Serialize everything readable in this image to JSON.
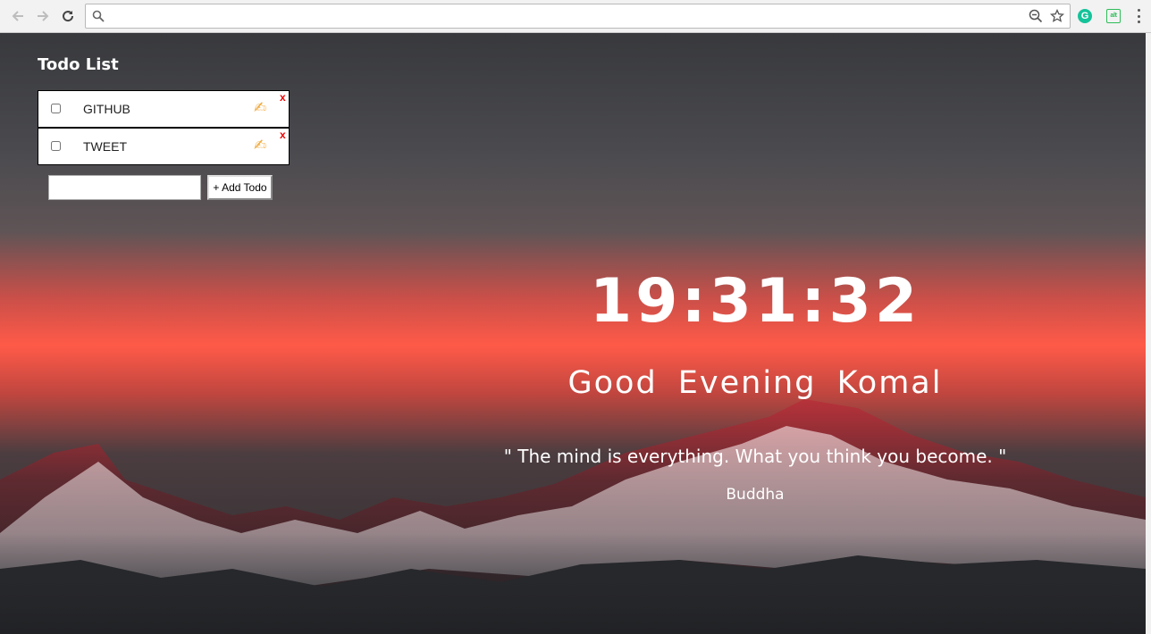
{
  "browser": {
    "address_value": "",
    "ext_grammarly": "G",
    "ext_alt": "alt"
  },
  "todo": {
    "title": "Todo List",
    "items": [
      {
        "label": "GITHUB",
        "edit_glyph": "✍",
        "delete_label": "x"
      },
      {
        "label": "TWEET",
        "edit_glyph": "✍",
        "delete_label": "x"
      }
    ],
    "input_value": "",
    "add_button_label": "+ Add Todo"
  },
  "clock": {
    "time": "19:31:32"
  },
  "greeting": {
    "text": "Good Evening Komal"
  },
  "quote": {
    "text": "\" The mind is everything. What you think you become. \"",
    "author": "Buddha"
  },
  "colors": {
    "sky_red": "#ff5a48",
    "delete_red": "#ee0000",
    "grammarly_green": "#15c39a"
  }
}
